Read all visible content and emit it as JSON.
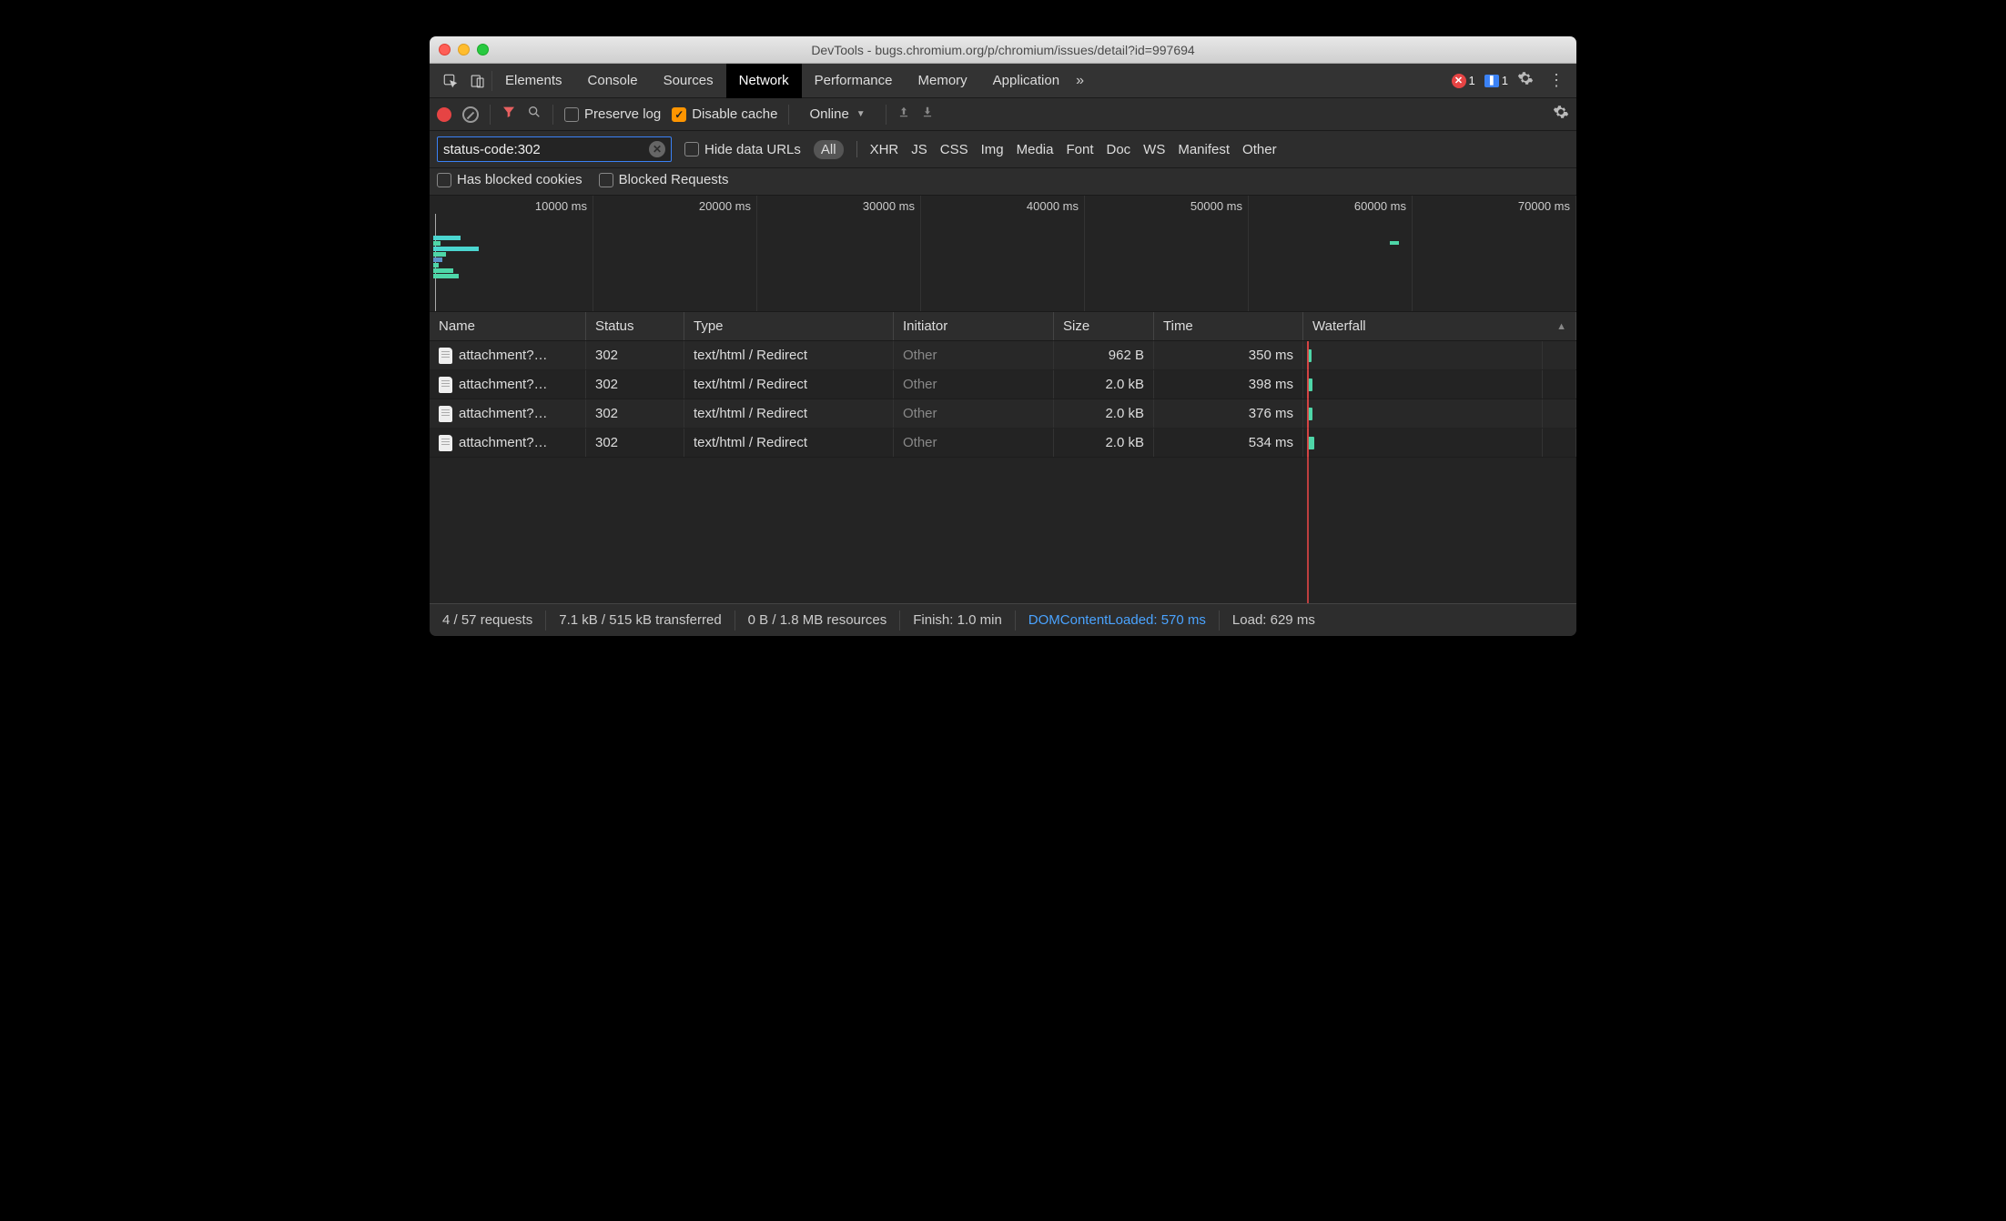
{
  "window": {
    "title": "DevTools - bugs.chromium.org/p/chromium/issues/detail?id=997694"
  },
  "main_tabs": {
    "items": [
      "Elements",
      "Console",
      "Sources",
      "Network",
      "Performance",
      "Memory",
      "Application"
    ],
    "active_index": 3,
    "overflow_indicator": "»",
    "error_count": "1",
    "info_count": "1"
  },
  "toolbar": {
    "preserve_log_label": "Preserve log",
    "preserve_log_checked": false,
    "disable_cache_label": "Disable cache",
    "disable_cache_checked": true,
    "throttling": "Online"
  },
  "filter": {
    "value": "status-code:302",
    "hide_data_urls_label": "Hide data URLs",
    "hide_data_urls_checked": false,
    "types": [
      "All",
      "XHR",
      "JS",
      "CSS",
      "Img",
      "Media",
      "Font",
      "Doc",
      "WS",
      "Manifest",
      "Other"
    ],
    "types_active_index": 0,
    "blocked_cookies_label": "Has blocked cookies",
    "blocked_cookies_checked": false,
    "blocked_requests_label": "Blocked Requests",
    "blocked_requests_checked": false
  },
  "overview": {
    "ticks": [
      "10000 ms",
      "20000 ms",
      "30000 ms",
      "40000 ms",
      "50000 ms",
      "60000 ms",
      "70000 ms"
    ]
  },
  "grid": {
    "headers": {
      "name": "Name",
      "status": "Status",
      "type": "Type",
      "initiator": "Initiator",
      "size": "Size",
      "time": "Time",
      "waterfall": "Waterfall"
    },
    "rows": [
      {
        "name": "attachment?…",
        "status": "302",
        "type": "text/html / Redirect",
        "initiator": "Other",
        "size": "962 B",
        "time": "350 ms",
        "wf_width": 4
      },
      {
        "name": "attachment?…",
        "status": "302",
        "type": "text/html / Redirect",
        "initiator": "Other",
        "size": "2.0 kB",
        "time": "398 ms",
        "wf_width": 5
      },
      {
        "name": "attachment?…",
        "status": "302",
        "type": "text/html / Redirect",
        "initiator": "Other",
        "size": "2.0 kB",
        "time": "376 ms",
        "wf_width": 5
      },
      {
        "name": "attachment?…",
        "status": "302",
        "type": "text/html / Redirect",
        "initiator": "Other",
        "size": "2.0 kB",
        "time": "534 ms",
        "wf_width": 7
      }
    ]
  },
  "status": {
    "requests": "4 / 57 requests",
    "transferred": "7.1 kB / 515 kB transferred",
    "resources": "0 B / 1.8 MB resources",
    "finish": "Finish: 1.0 min",
    "dcl": "DOMContentLoaded: 570 ms",
    "load": "Load: 629 ms"
  }
}
